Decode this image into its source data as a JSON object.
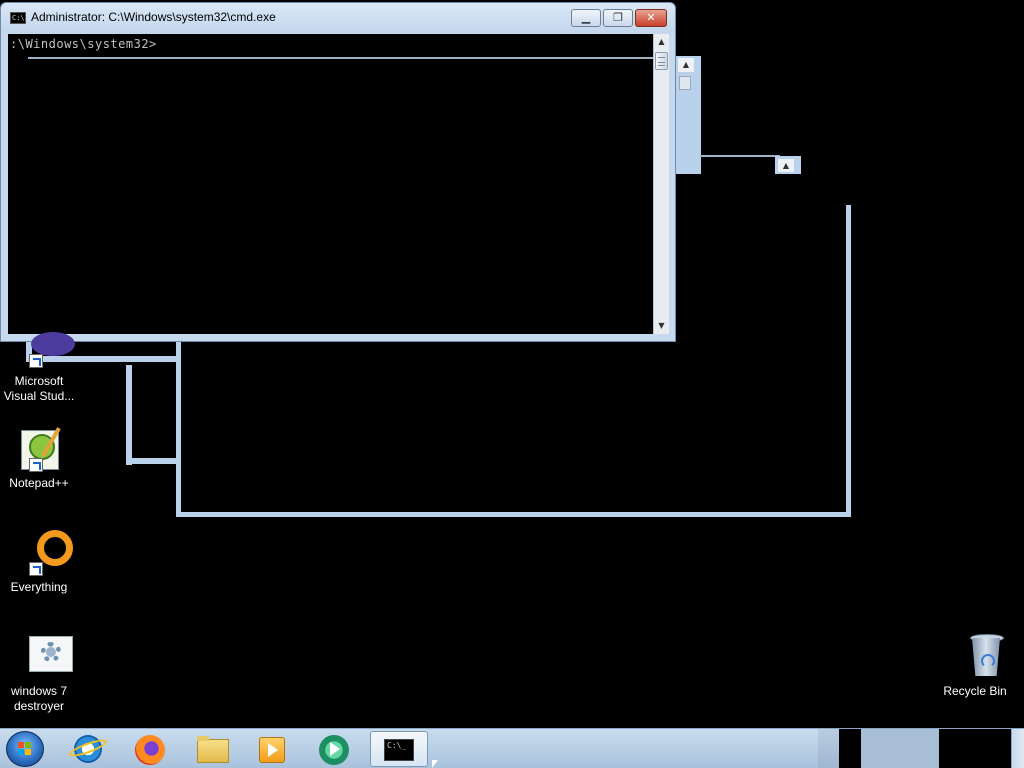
{
  "cmd_window": {
    "title": "Administrator: C:\\Windows\\system32\\cmd.exe",
    "prompt": ":\\Windows\\system32>",
    "icon_label": "C:\\",
    "minimize": "▁",
    "maximize": "❐",
    "close": "✕"
  },
  "desktop_icons": [
    {
      "label_line1": "Microsoft",
      "label_line2": "Visual Stud...",
      "icon": "visual-studio-icon"
    },
    {
      "label_line1": "Notepad++",
      "label_line2": "",
      "icon": "notepadpp-icon"
    },
    {
      "label_line1": "Everything",
      "label_line2": "",
      "icon": "everything-search-icon"
    },
    {
      "label_line1": "windows 7",
      "label_line2": "destroyer",
      "icon": "settings-gear-icon"
    },
    {
      "label_line1": "Recycle Bin",
      "label_line2": "",
      "icon": "recycle-bin-icon"
    }
  ],
  "taskbar": {
    "items": [
      {
        "name": "start-button",
        "icon": "windows-start-icon"
      },
      {
        "name": "internet-explorer",
        "icon": "ie-icon"
      },
      {
        "name": "firefox",
        "icon": "firefox-icon"
      },
      {
        "name": "file-explorer",
        "icon": "folder-icon"
      },
      {
        "name": "media-player",
        "icon": "media-player-icon"
      },
      {
        "name": "app-circle",
        "icon": "media-center-icon"
      },
      {
        "name": "cmd",
        "icon": "cmd-icon",
        "label": "C:\\_"
      }
    ]
  }
}
